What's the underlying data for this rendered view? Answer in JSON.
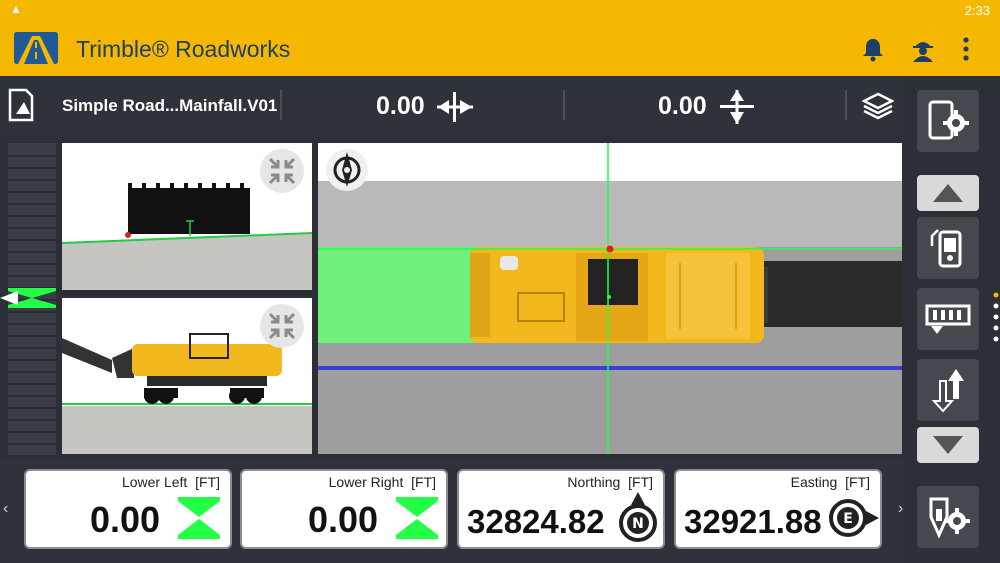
{
  "status_bar": {
    "time": "2:33",
    "warning_icon": "warning-icon"
  },
  "app_bar": {
    "title": "Trimble® Roadworks",
    "icons": [
      "notification-bell-icon",
      "worker-profile-icon",
      "overflow-menu-icon"
    ]
  },
  "toolbar": {
    "design_name": "Simple Road...Mainfall.V01",
    "offset_value": "0.00",
    "elevation_value": "0.00",
    "icons": [
      "design-file-icon",
      "horizontal-offset-icon",
      "vertical-offset-icon",
      "layers-icon"
    ]
  },
  "rail": {
    "icons": [
      "device-settings-icon",
      "scroll-up-icon",
      "mobile-device-icon",
      "milling-drum-icon",
      "elevation-swap-icon",
      "scroll-down-icon",
      "machine-settings-icon"
    ],
    "page_indicator": {
      "count": 5,
      "active_index": 1
    }
  },
  "views": {
    "profile_top": "profile-view",
    "side_view": "side-view",
    "plan_view": "plan-view",
    "compass_icon": "north-compass-icon",
    "collapse_icon": "collapse-view-icon"
  },
  "readouts": [
    {
      "label": "Lower Left",
      "unit": "[FT]",
      "value": "0.00",
      "icon": "on-grade-icon"
    },
    {
      "label": "Lower Right",
      "unit": "[FT]",
      "value": "0.00",
      "icon": "on-grade-icon"
    },
    {
      "label": "Northing",
      "unit": "[FT]",
      "value": "32824.82",
      "icon": "north-compass-icon"
    },
    {
      "label": "Easting",
      "unit": "[FT]",
      "value": "32921.88",
      "icon": "east-compass-icon"
    }
  ],
  "bottom_pager": {
    "count": 8,
    "active_index": 0
  },
  "colors": {
    "brand_yellow": "#f6b700",
    "on_grade_green": "#22ff44",
    "plan_green": "#6ef07a",
    "line_blue": "#3a3fd0"
  }
}
